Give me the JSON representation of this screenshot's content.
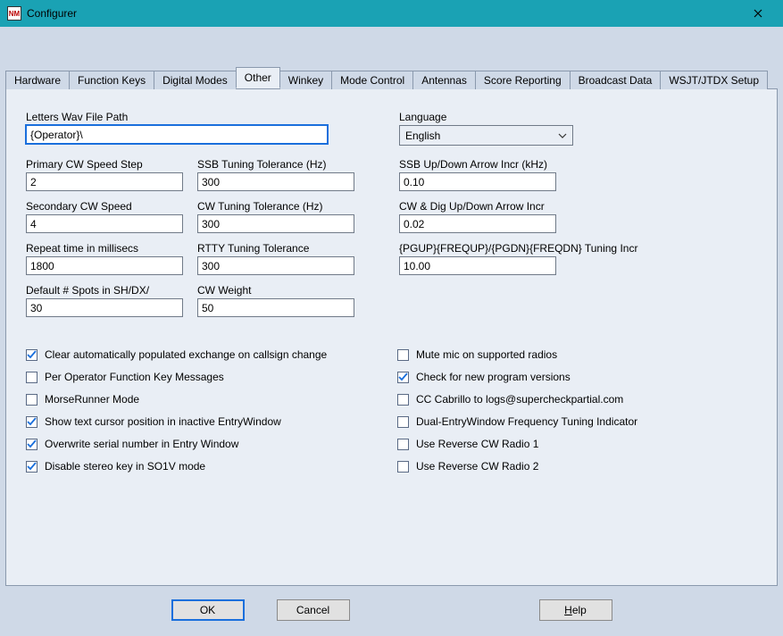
{
  "window": {
    "title": "Configurer",
    "app_icon_text": "NM"
  },
  "tabs": [
    {
      "id": "hardware",
      "label": "Hardware"
    },
    {
      "id": "function-keys",
      "label": "Function Keys"
    },
    {
      "id": "digital-modes",
      "label": "Digital Modes"
    },
    {
      "id": "other",
      "label": "Other",
      "active": true
    },
    {
      "id": "winkey",
      "label": "Winkey"
    },
    {
      "id": "mode-control",
      "label": "Mode Control"
    },
    {
      "id": "antennas",
      "label": "Antennas"
    },
    {
      "id": "score-reporting",
      "label": "Score Reporting"
    },
    {
      "id": "broadcast-data",
      "label": "Broadcast Data"
    },
    {
      "id": "wsjt",
      "label": "WSJT/JTDX Setup"
    }
  ],
  "labels": {
    "letters_wav": "Letters Wav File Path",
    "language": "Language",
    "primary_cw_speed_step": "Primary CW Speed Step",
    "ssb_tuning_tol": "SSB Tuning Tolerance (Hz)",
    "ssb_updown_arrow": "SSB Up/Down Arrow Incr (kHz)",
    "secondary_cw_speed": "Secondary CW Speed",
    "cw_tuning_tol": "CW Tuning Tolerance (Hz)",
    "cw_dig_updown": "CW & Dig Up/Down Arrow Incr",
    "repeat_time": "Repeat time in millisecs",
    "rtty_tuning_tol": "RTTY Tuning Tolerance",
    "pgup_pgdn": "{PGUP}{FREQUP}/{PGDN}{FREQDN} Tuning Incr",
    "default_spots": "Default # Spots in SH/DX/",
    "cw_weight": "CW Weight"
  },
  "values": {
    "letters_wav": "{Operator}\\",
    "language": "English",
    "primary_cw_speed_step": "2",
    "ssb_tuning_tol": "300",
    "ssb_updown_arrow": "0.10",
    "secondary_cw_speed": "4",
    "cw_tuning_tol": "300",
    "cw_dig_updown": "0.02",
    "repeat_time": "1800",
    "rtty_tuning_tol": "300",
    "pgup_pgdn": "10.00",
    "default_spots": "30",
    "cw_weight": "50"
  },
  "checks_left": [
    {
      "id": "clear-exchange",
      "label": "Clear automatically populated exchange on callsign change",
      "checked": true
    },
    {
      "id": "per-operator-fk",
      "label": "Per Operator Function Key Messages",
      "checked": false
    },
    {
      "id": "morserunner",
      "label": "MorseRunner Mode",
      "checked": false
    },
    {
      "id": "show-text-cursor",
      "label": "Show text cursor position in inactive EntryWindow",
      "checked": true
    },
    {
      "id": "overwrite-serial",
      "label": "Overwrite serial number in Entry Window",
      "checked": true
    },
    {
      "id": "disable-stereo",
      "label": "Disable stereo key in SO1V mode",
      "checked": true
    }
  ],
  "checks_right": [
    {
      "id": "mute-mic",
      "label": "Mute mic on supported radios",
      "checked": false
    },
    {
      "id": "check-updates",
      "label": "Check for new program versions",
      "checked": true
    },
    {
      "id": "cc-cabrillo",
      "label": "CC Cabrillo to logs@supercheckpartial.com",
      "checked": false
    },
    {
      "id": "dual-entry-tuning",
      "label": "Dual-EntryWindow Frequency Tuning Indicator",
      "checked": false
    },
    {
      "id": "reverse-cw-1",
      "label": "Use Reverse CW Radio 1",
      "checked": false
    },
    {
      "id": "reverse-cw-2",
      "label": "Use Reverse CW Radio 2",
      "checked": false
    }
  ],
  "buttons": {
    "ok": "OK",
    "cancel": "Cancel",
    "help_u": "H",
    "help_rest": "elp"
  }
}
